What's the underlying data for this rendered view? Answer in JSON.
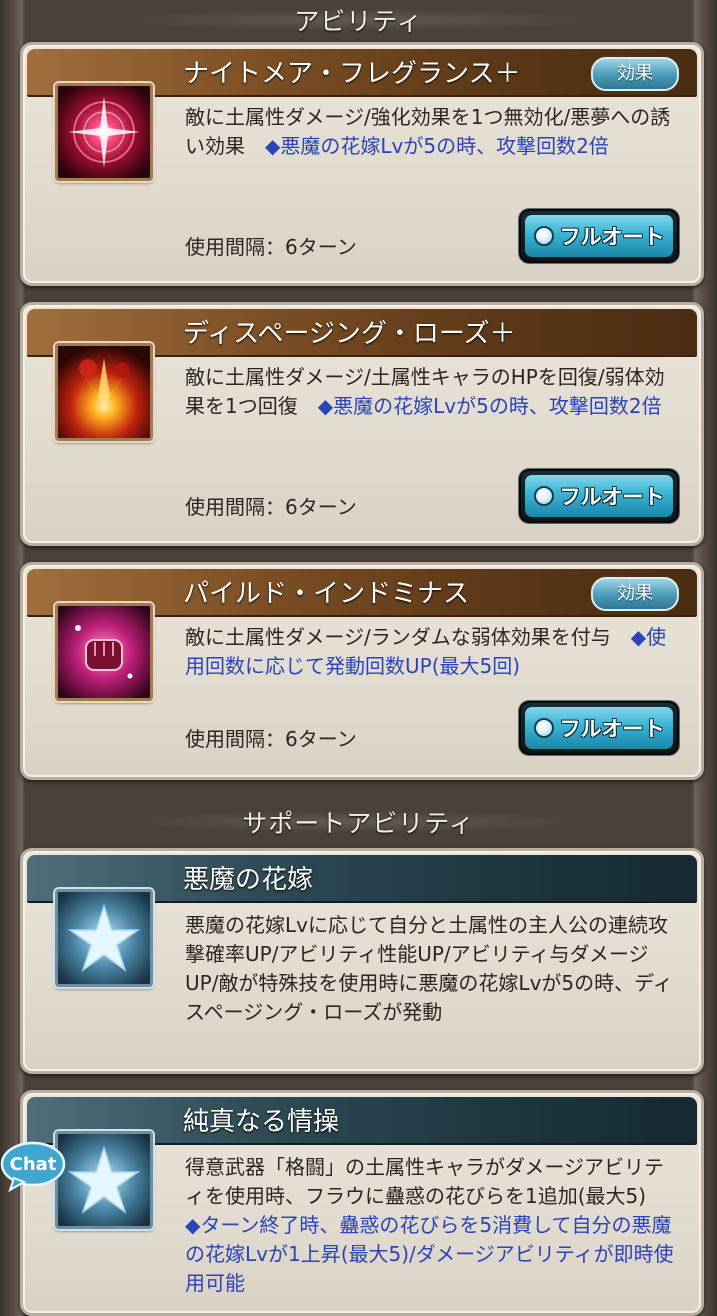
{
  "sections": {
    "abilities_title": "アビリティ",
    "support_title": "サポートアビリティ"
  },
  "abilities": [
    {
      "name": "ナイトメア・フレグランス＋",
      "badge": "効果",
      "desc_text": "敵に土属性ダメージ/強化効果を1つ無効化/悪夢への誘い効果　",
      "desc_highlight": "◆悪魔の花嫁Lvが5の時、攻撃回数2倍",
      "interval": "使用間隔：6ターン",
      "button": "フルオート",
      "icon": "nightmare-rose-icon"
    },
    {
      "name": "ディスページング・ローズ＋",
      "badge": "",
      "desc_text": "敵に土属性ダメージ/土属性キャラのHPを回復/弱体効果を1つ回復　",
      "desc_highlight": "◆悪魔の花嫁Lvが5の時、攻撃回数2倍",
      "interval": "使用間隔：6ターン",
      "button": "フルオート",
      "icon": "burst-flower-icon"
    },
    {
      "name": "パイルド・インドミナス",
      "badge": "効果",
      "desc_text": "敵に土属性ダメージ/ランダムな弱体効果を付与　",
      "desc_highlight": "◆使用回数に応じて発動回数UP(最大5回)",
      "interval": "使用間隔：6ターン",
      "button": "フルオート",
      "icon": "fist-icon"
    }
  ],
  "supports": [
    {
      "name": "悪魔の花嫁",
      "desc_text": "悪魔の花嫁Lvに応じて自分と土属性の主人公の連続攻撃確率UP/アビリティ性能UP/アビリティ与ダメージUP/敵が特殊技を使用時に悪魔の花嫁Lvが5の時、ディスページング・ローズが発動",
      "desc_highlight": "",
      "icon": "star-icon"
    },
    {
      "name": "純真なる情操",
      "desc_text": "得意武器「格闘」の土属性キャラがダメージアビリティを使用時、フラウに蠱惑の花びらを1追加(最大5)　",
      "desc_highlight": "◆ターン終了時、蠱惑の花びらを5消費して自分の悪魔の花嫁Lvが1上昇(最大5)/ダメージアビリティが即時使用可能",
      "icon": "star-icon"
    }
  ],
  "chat": {
    "label": "Chat"
  }
}
